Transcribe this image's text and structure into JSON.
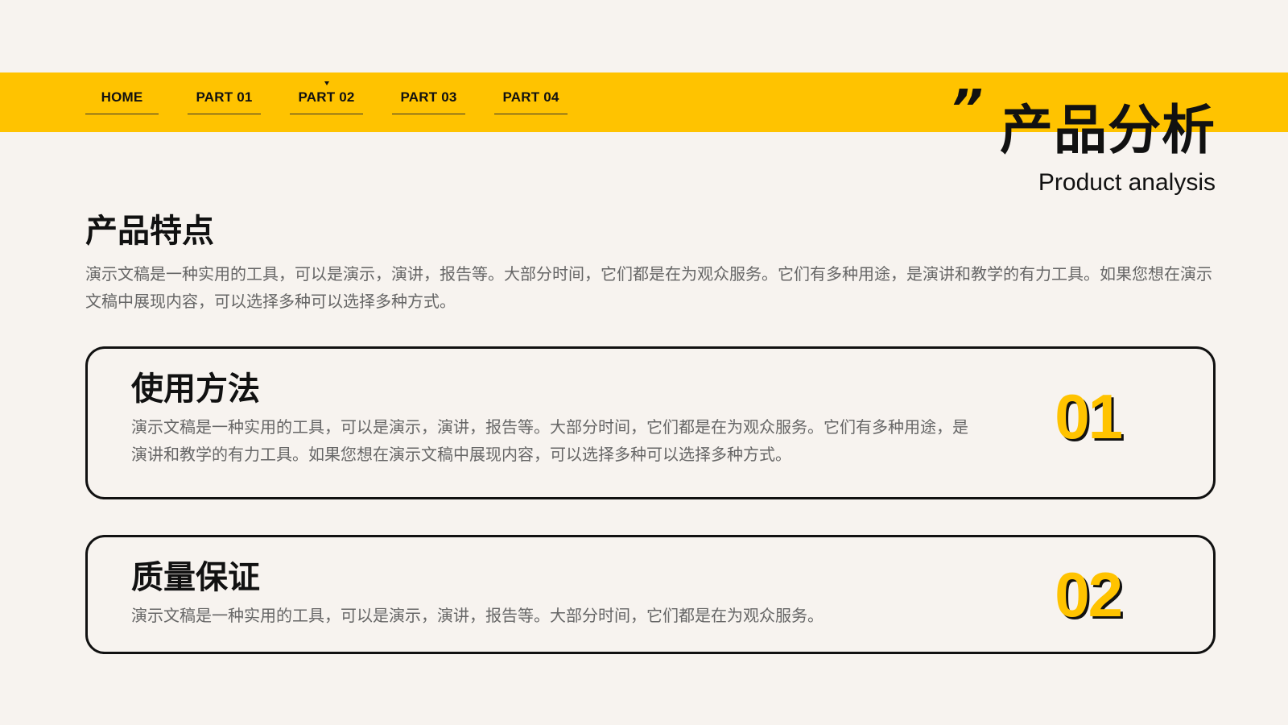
{
  "colors": {
    "accent": "#ffc300",
    "background": "#f7f3ef",
    "text": "#111111",
    "muted_text": "#666666"
  },
  "nav": {
    "items": [
      {
        "label": "HOME"
      },
      {
        "label": "PART 01"
      },
      {
        "label": "PART 02",
        "active": true
      },
      {
        "label": "PART 03"
      },
      {
        "label": "PART 04"
      }
    ]
  },
  "header": {
    "quote_mark": "”",
    "title": "产品分析",
    "subtitle": "Product analysis"
  },
  "section": {
    "title": "产品特点",
    "description": "演示文稿是一种实用的工具，可以是演示，演讲，报告等。大部分时间，它们都是在为观众服务。它们有多种用途，是演讲和教学的有力工具。如果您想在演示文稿中展现内容，可以选择多种可以选择多种方式。"
  },
  "cards": [
    {
      "title": "使用方法",
      "description": "演示文稿是一种实用的工具，可以是演示，演讲，报告等。大部分时间，它们都是在为观众服务。它们有多种用途，是演讲和教学的有力工具。如果您想在演示文稿中展现内容，可以选择多种可以选择多种方式。",
      "number": "01"
    },
    {
      "title": "质量保证",
      "description": "演示文稿是一种实用的工具，可以是演示，演讲，报告等。大部分时间，它们都是在为观众服务。",
      "number": "02"
    }
  ]
}
